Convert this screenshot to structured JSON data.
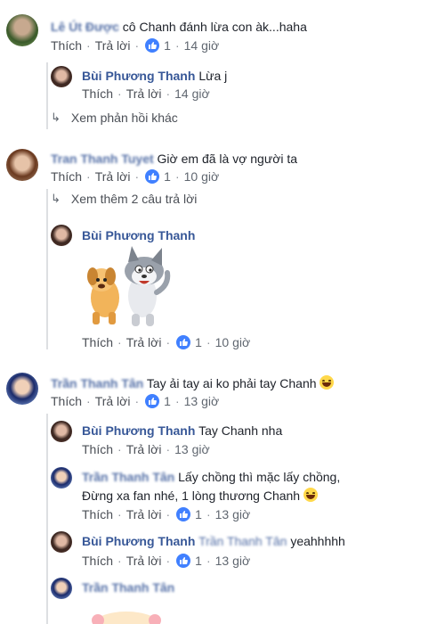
{
  "actions": {
    "like": "Thích",
    "reply": "Trả lời"
  },
  "comments": [
    {
      "author": "Lê Út Được",
      "text": "cô Chanh đánh lừa con àk...haha",
      "likes": "1",
      "time": "14 giờ"
    },
    {
      "author": "Bùi Phương Thanh",
      "text": "Lừa j",
      "time": "14 giờ"
    },
    {
      "more": "Xem phản hồi khác"
    },
    {
      "author": "Tran Thanh Tuyet",
      "text": "Giờ em đã là vợ người ta",
      "likes": "1",
      "time": "10 giờ"
    },
    {
      "more": "Xem thêm 2 câu trả lời"
    },
    {
      "author": "Bùi Phương Thanh",
      "sticker": "dog-and-cat-sticker",
      "likes": "1",
      "time": "10 giờ"
    },
    {
      "author": "Trần Thanh Tân",
      "text": "Tay ải tay ai ko phải tay Chanh",
      "likes": "1",
      "time": "13 giờ"
    },
    {
      "author": "Bùi Phương Thanh",
      "text": "Tay Chanh nha",
      "time": "13 giờ"
    },
    {
      "author": "Trần Thanh Tân",
      "text_line1": "Lấy chồng thì mặc lấy chồng,",
      "text_line2": "Đừng xa fan nhé, 1 lòng thương Chanh",
      "likes": "1",
      "time": "13 giờ"
    },
    {
      "author": "Bùi Phương Thanh",
      "mention": "Trần Thanh Tân",
      "text": "yeahhhhh",
      "likes": "1",
      "time": "13 giờ"
    },
    {
      "author": "Trần Thanh Tân"
    }
  ],
  "colors": {
    "name": "#385898",
    "like_badge": "#4080ff",
    "thread_line": "#dddfe2"
  }
}
